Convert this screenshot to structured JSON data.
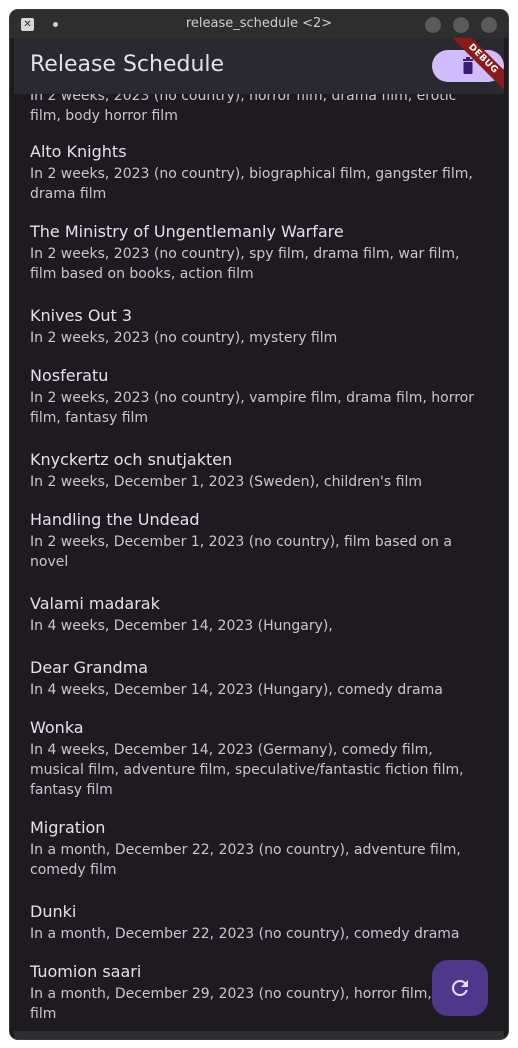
{
  "window": {
    "title": "release_schedule <2>",
    "app_icon": "x-app-icon"
  },
  "appbar": {
    "title": "Release Schedule",
    "delete_icon": "trash-icon",
    "debug_label": "DEBUG"
  },
  "items": [
    {
      "name": "",
      "desc": "In 2 weeks, 2023 (no country), horror film, drama film, erotic film, body horror film"
    },
    {
      "name": "Alto Knights",
      "desc": "In 2 weeks, 2023 (no country), biographical film, gangster film, drama film"
    },
    {
      "name": "The Ministry of Ungentlemanly Warfare",
      "desc": "In 2 weeks, 2023 (no country), spy film, drama film, war film, film based on books, action film"
    },
    {
      "name": "Knives Out 3",
      "desc": "In 2 weeks, 2023 (no country), mystery film"
    },
    {
      "name": "Nosferatu",
      "desc": "In 2 weeks, 2023 (no country), vampire film, drama film, horror film, fantasy film"
    },
    {
      "name": "Knyckertz och snutjakten",
      "desc": "In 2 weeks, December 1, 2023 (Sweden), children's film"
    },
    {
      "name": "Handling the Undead",
      "desc": "In 2 weeks, December 1, 2023 (no country), film based on a novel"
    },
    {
      "name": "Valami madarak",
      "desc": "In 4 weeks, December 14, 2023 (Hungary),"
    },
    {
      "name": "Dear Grandma",
      "desc": "In 4 weeks, December 14, 2023 (Hungary), comedy drama"
    },
    {
      "name": "Wonka",
      "desc": "In 4 weeks, December 14, 2023 (Germany), comedy film, musical film, adventure film, speculative/fantastic fiction film, fantasy film"
    },
    {
      "name": "Migration",
      "desc": "In a month, December 22, 2023 (no country), adventure film, comedy film"
    },
    {
      "name": "Dunki",
      "desc": "In a month, December 22, 2023 (no country), comedy drama"
    },
    {
      "name": "Tuomion saari",
      "desc": "In a month, December 29, 2023 (no country), horror film, slasher film"
    }
  ],
  "fab": {
    "icon": "refresh-icon"
  },
  "colors": {
    "background": "#1d1b20",
    "appbar": "#2b2930",
    "primary_container": "#d0bcff",
    "fab": "#4f378b"
  }
}
